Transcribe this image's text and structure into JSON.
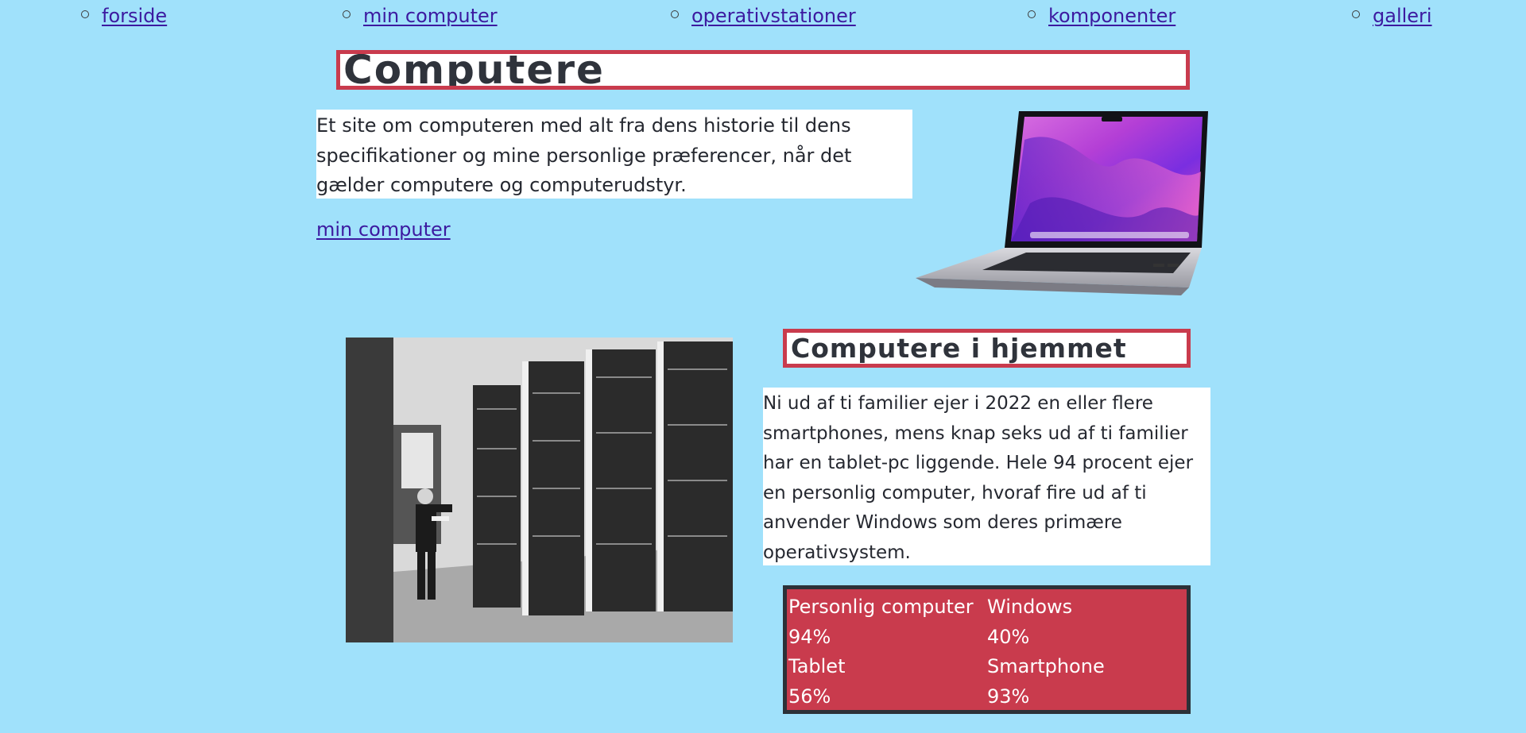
{
  "nav": {
    "items": [
      {
        "label": "forside"
      },
      {
        "label": "min computer"
      },
      {
        "label": "operativstationer"
      },
      {
        "label": "komponenter"
      },
      {
        "label": "galleri"
      }
    ]
  },
  "header": {
    "title": "Computere"
  },
  "intro": {
    "text": "Et site om computeren med alt fra dens historie til dens specifikationer og mine personlige præferencer, når det gælder computere og computerudstyr.",
    "link_label": "min computer"
  },
  "section": {
    "title": "Computere i hjemmet",
    "text": "Ni ud af ti familier ejer i 2022 en eller flere smartphones, mens knap seks ud af ti familier har en tablet-pc liggende. Hele 94 procent ejer en personlig computer, hvoraf fire ud af ti anvender Windows som deres primære operativsystem."
  },
  "stats": {
    "rows": [
      [
        "Personlig computer",
        "Windows"
      ],
      [
        "94%",
        "40%"
      ],
      [
        "Tablet",
        "Smartphone"
      ],
      [
        "56%",
        "93%"
      ]
    ]
  },
  "colors": {
    "background": "#a0e1fb",
    "accent": "#c93b4d",
    "link": "#3c1aa0",
    "table_border": "#2c3138"
  },
  "icons": {
    "laptop": "laptop-image",
    "photo": "server-room-photo"
  }
}
